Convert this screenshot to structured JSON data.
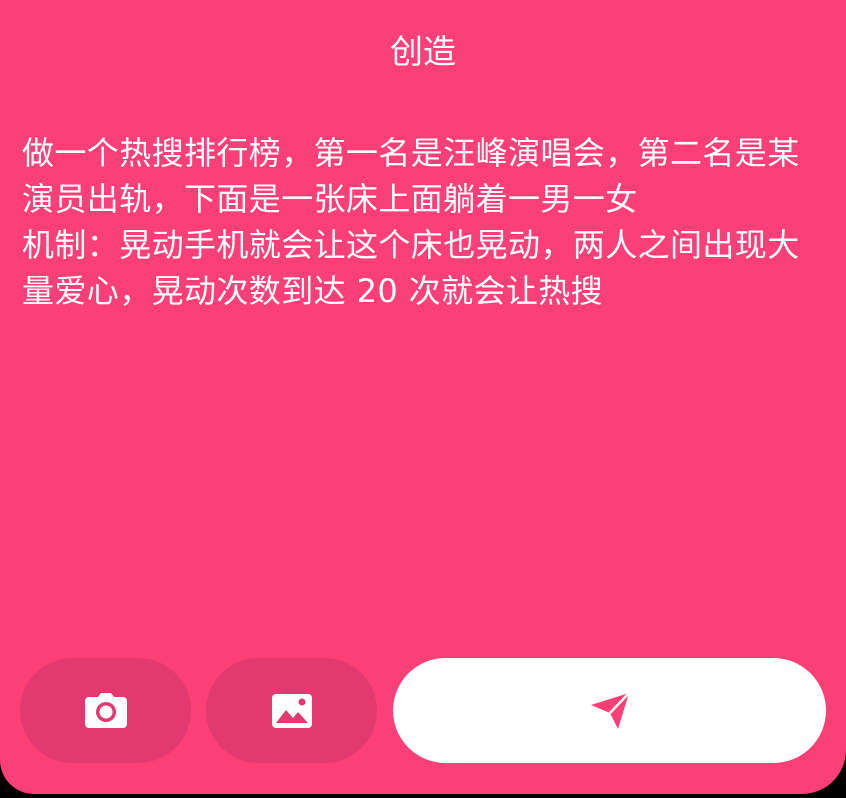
{
  "header": {
    "title": "创造"
  },
  "prompt": {
    "text": "做一个热搜排行榜，第一名是汪峰演唱会，第二名是某演员出轨，下面是一张床上面躺着一男一女\n机制：晃动手机就会让这个床也晃动，两人之间出现大量爱心，晃动次数到达 20 次就会让热搜"
  },
  "toolbar": {
    "camera_icon": "camera-icon",
    "gallery_icon": "image-icon",
    "send_icon": "send-icon"
  },
  "colors": {
    "background": "#fd3f78",
    "button_secondary": "#e23a70",
    "send_button": "#ffffff",
    "accent": "#fd3f78"
  }
}
